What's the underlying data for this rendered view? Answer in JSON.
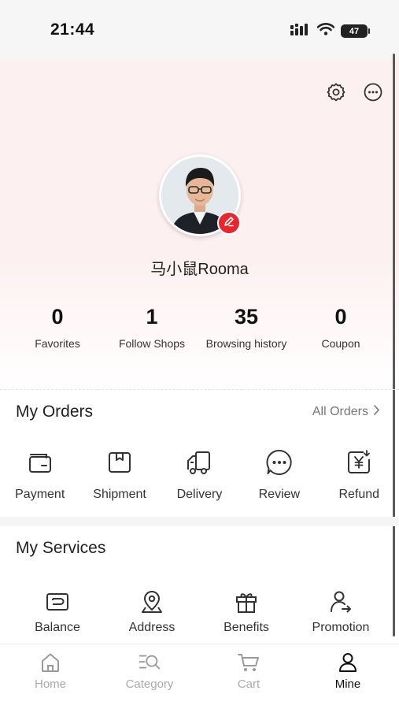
{
  "status_bar": {
    "time": "21:44",
    "battery": "47"
  },
  "profile": {
    "username": "马小鼠Rooma",
    "stats": [
      {
        "value": "0",
        "label": "Favorites"
      },
      {
        "value": "1",
        "label": "Follow Shops"
      },
      {
        "value": "35",
        "label": "Browsing history"
      },
      {
        "value": "0",
        "label": "Coupon"
      }
    ]
  },
  "orders": {
    "title": "My Orders",
    "all_orders": "All Orders",
    "items": [
      {
        "label": "Payment",
        "icon": "wallet-icon"
      },
      {
        "label": "Shipment",
        "icon": "package-icon"
      },
      {
        "label": "Delivery",
        "icon": "truck-icon"
      },
      {
        "label": "Review",
        "icon": "chat-bubble-icon"
      },
      {
        "label": "Refund",
        "icon": "refund-yen-icon"
      }
    ]
  },
  "services": {
    "title": "My Services",
    "items": [
      {
        "label": "Balance",
        "icon": "balance-card-icon"
      },
      {
        "label": "Address",
        "icon": "location-pin-icon"
      },
      {
        "label": "Benefits",
        "icon": "gift-icon"
      },
      {
        "label": "Promotion",
        "icon": "user-share-icon"
      }
    ]
  },
  "tabs": [
    {
      "label": "Home",
      "icon": "home-icon",
      "active": false
    },
    {
      "label": "Category",
      "icon": "category-search-icon",
      "active": false
    },
    {
      "label": "Cart",
      "icon": "cart-icon",
      "active": false
    },
    {
      "label": "Mine",
      "icon": "user-icon",
      "active": true
    }
  ],
  "colors": {
    "accent": "#e8262e",
    "header_bg": "#fdf0f1",
    "active_tab": "#111111",
    "inactive_tab": "#aaaaaa"
  }
}
